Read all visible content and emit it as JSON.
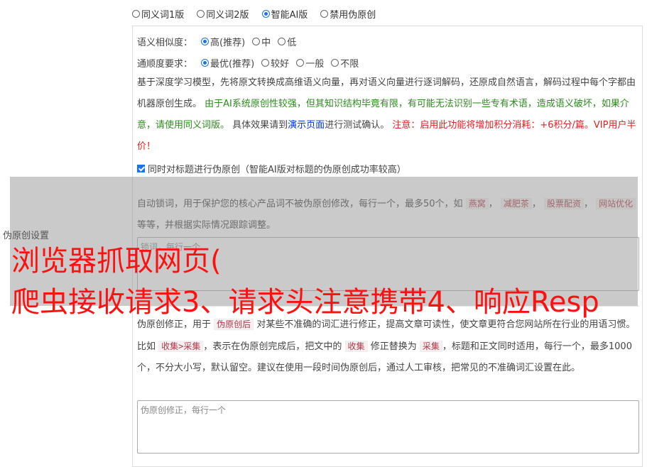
{
  "mode_options": [
    {
      "label": "同义词1版",
      "selected": false
    },
    {
      "label": "同义词2版",
      "selected": false
    },
    {
      "label": "智能AI版",
      "selected": true
    },
    {
      "label": "禁用伪原创",
      "selected": false
    }
  ],
  "similarity": {
    "label": "语义相似度：",
    "options": [
      {
        "label": "高(推荐)",
        "selected": true
      },
      {
        "label": "中",
        "selected": false
      },
      {
        "label": "低",
        "selected": false
      }
    ]
  },
  "fluency": {
    "label": "通顺度要求：",
    "options": [
      {
        "label": "最优(推荐)",
        "selected": true
      },
      {
        "label": "较好",
        "selected": false
      },
      {
        "label": "一般",
        "selected": false
      },
      {
        "label": "不限",
        "selected": false
      }
    ]
  },
  "description": {
    "part1": "基于深度学习模型，先将原文转换成高维语义向量，再对语义向量进行逐词解码，还原成自然语言，解码过程中每个字都由机器原创生成。",
    "part2_green": "由于AI系统原创性较强，但其知识结构毕竟有限，有可能无法识别一些专有术语，造成语义破坏，如果介意，请使用同义词版。",
    "part3": "具体效果请到",
    "link": "演示页面",
    "part4": "进行测试确认。",
    "part5_red": "注意：启用此功能将增加积分消耗：+6积分/篇。VIP用户半价！"
  },
  "title_checkbox": {
    "label": "同时对标题进行伪原创（智能AI版对标题的伪原创成功率较高）",
    "checked": true
  },
  "lock_words": {
    "desc_prefix": "自动锁词，用于保护您的核心产品词不被伪原创修改，每行一个，最多50个，如",
    "tags": [
      "燕窝",
      "减肥茶",
      "股票配资",
      "网站优化"
    ],
    "desc_suffix": "等等，并根据实际情况跟踪调整。",
    "placeholder": "锁词，每行一个"
  },
  "side_label": "伪原创设置",
  "overlay_text": {
    "line1": "浏览器抓取网页(",
    "line2": "爬虫接收请求3、请求头注意携带4、响应Resp"
  },
  "correction": {
    "desc1": "伪原创修正，用于",
    "tag1": "伪原创后",
    "desc2": "对某些不准确的词汇进行修正，提高文章可读性，使文章更符合您网站所在行业的用语习惯。比如",
    "tag2": "收集>采集",
    "desc3": "，表示在伪原创完成后，把文中的",
    "tag3": "收集",
    "desc4": "修正替换为",
    "tag4": "采集",
    "desc5": "，标题和正文同时适用，每行一个，最多1000个，不分大小写，默认留空。建议在使用一段时间伪原创后，通过人工审核，把常见的不准确词汇设置在此。",
    "placeholder": "伪原创修正，每行一个"
  }
}
